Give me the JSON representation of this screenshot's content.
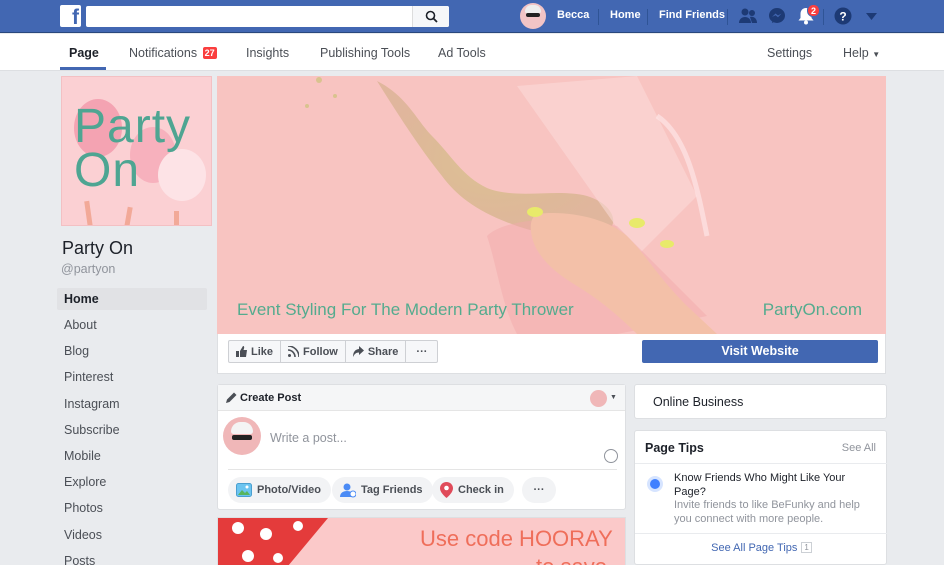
{
  "topbar": {
    "logo": "f",
    "search_placeholder": "",
    "user_name": "Becca",
    "home_label": "Home",
    "find_friends_label": "Find Friends",
    "notifications_count": "2",
    "brand_color": "#4267b2"
  },
  "subnav": {
    "tabs": [
      {
        "label": "Page",
        "active": true
      },
      {
        "label": "Notifications",
        "badge": "27"
      },
      {
        "label": "Insights"
      },
      {
        "label": "Publishing Tools"
      },
      {
        "label": "Ad Tools"
      }
    ],
    "settings_label": "Settings",
    "help_label": "Help"
  },
  "page": {
    "profile_text_line1": "Party",
    "profile_text_line2": "On",
    "name": "Party On",
    "handle": "@partyon"
  },
  "left_nav": {
    "items": [
      "Home",
      "About",
      "Blog",
      "Pinterest",
      "Instagram",
      "Subscribe",
      "Mobile",
      "Explore",
      "Photos",
      "Videos",
      "Posts"
    ]
  },
  "cover": {
    "caption": "Event Styling For The Modern Party Thrower",
    "url": "PartyOn.com"
  },
  "actions": {
    "like": "Like",
    "follow": "Follow",
    "share": "Share",
    "more": "···",
    "visit_website": "Visit Website"
  },
  "composer": {
    "header": "Create Post",
    "placeholder": "Write a post...",
    "photo_video": "Photo/Video",
    "tag_friends": "Tag Friends",
    "check_in": "Check in",
    "more": "···"
  },
  "promo": {
    "line1": "Use code HOORAY",
    "line2": "to save"
  },
  "sidebar": {
    "online_business": "Online Business",
    "tips_title": "Page Tips",
    "tips_see_all": "See All",
    "tip_title": "Know Friends Who Might Like Your Page?",
    "tip_body": "Invite friends to like BeFunky and help you connect with more people.",
    "footer_label": "See All Page Tips",
    "footer_count": "1"
  }
}
